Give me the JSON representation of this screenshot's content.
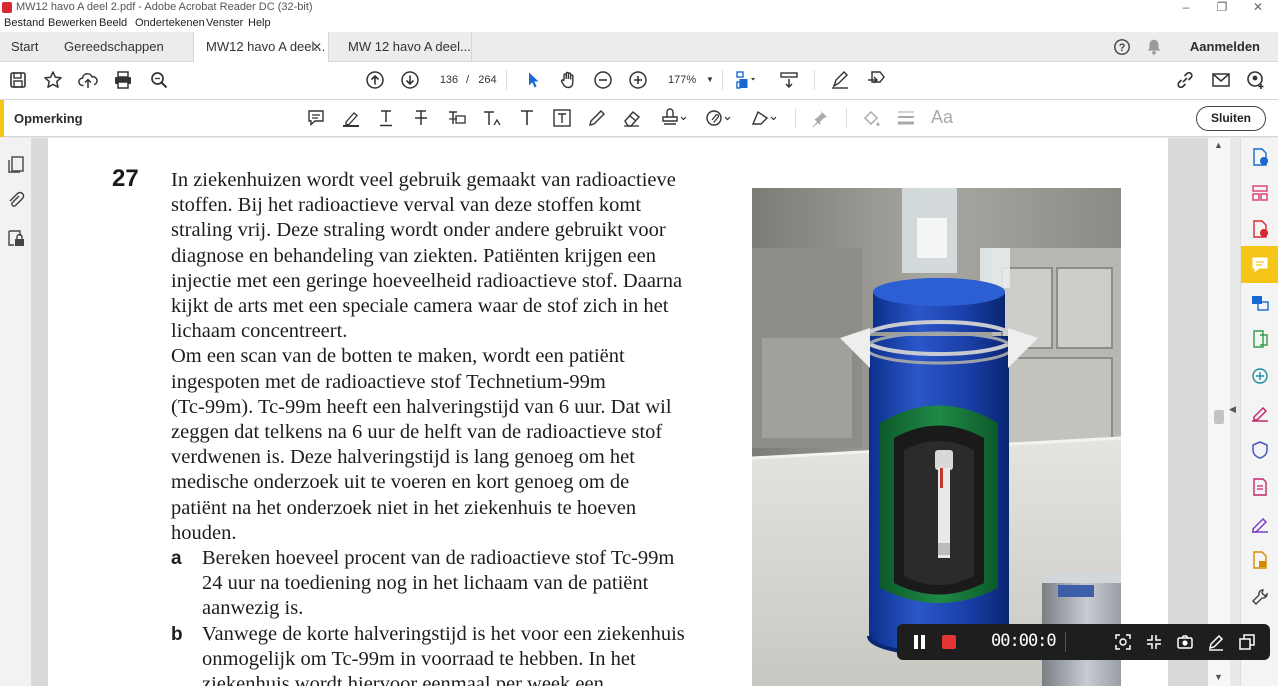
{
  "window": {
    "title": "MW12 havo A deel 2.pdf - Adobe Acrobat Reader DC (32-bit)",
    "minimize": "–",
    "maximize": "❐",
    "close": "✕"
  },
  "menu": [
    "Bestand",
    "Bewerken",
    "Beeld",
    "Ondertekenen",
    "Venster",
    "Help"
  ],
  "tabs": {
    "home": "Start",
    "tools": "Gereedschappen",
    "doc1": "MW12 havo A deel...",
    "doc1_close": "✕",
    "doc2": "MW 12 havo A deel...",
    "signin": "Aanmelden",
    "help_icon": "help-icon",
    "bell_icon": "notifications-icon"
  },
  "toolbar": {
    "page_current": "136",
    "page_separator": "/",
    "page_total": "264",
    "zoom": "177%"
  },
  "comment_toolbar": {
    "label": "Opmerking",
    "close_label": "Sluiten",
    "accent_color": "#f5c518"
  },
  "document": {
    "question_number": "27",
    "intro_lines": [
      "In ziekenhuizen wordt veel gebruik gemaakt van radioactieve",
      "stoffen. Bij het radioactieve verval van deze stoffen komt",
      "straling vrij. Deze straling wordt onder andere gebruikt voor",
      "diagnose en behandeling van ziekten. Patiënten krijgen een",
      "injectie met een geringe hoeveelheid radioactieve stof. Daarna",
      "kijkt de arts met een speciale camera waar de stof zich in het",
      "lichaam concentreert.",
      "Om een scan van de botten te maken, wordt een patiënt",
      "ingespoten met de radioactieve stof Technetium-99m",
      "(Tc-99m). Tc-99m heeft een halveringstijd van 6 uur. Dat wil",
      "zeggen dat telkens na 6 uur de helft van de radioactieve stof",
      "verdwenen is. Deze halveringstijd is lang genoeg om het",
      "medische onderzoek uit te voeren en kort genoeg om de",
      "patiënt na het onderzoek niet in het ziekenhuis te hoeven",
      "houden."
    ],
    "sub_a": {
      "letter": "a",
      "lines": [
        "Bereken hoeveel procent van de radioactieve stof Tc-99m",
        "24 uur na toediening nog in het lichaam van de patiënt",
        "aanwezig is."
      ]
    },
    "sub_b": {
      "letter": "b",
      "lines": [
        "Vanwege de korte halveringstijd is het voor een ziekenhuis",
        "onmogelijk om Tc-99m in voorraad te hebben. In het",
        "ziekenhuis wordt hiervoor eenmaal per week een"
      ]
    }
  },
  "recorder": {
    "time": "00:00:0",
    "stop_color": "#e43434"
  }
}
